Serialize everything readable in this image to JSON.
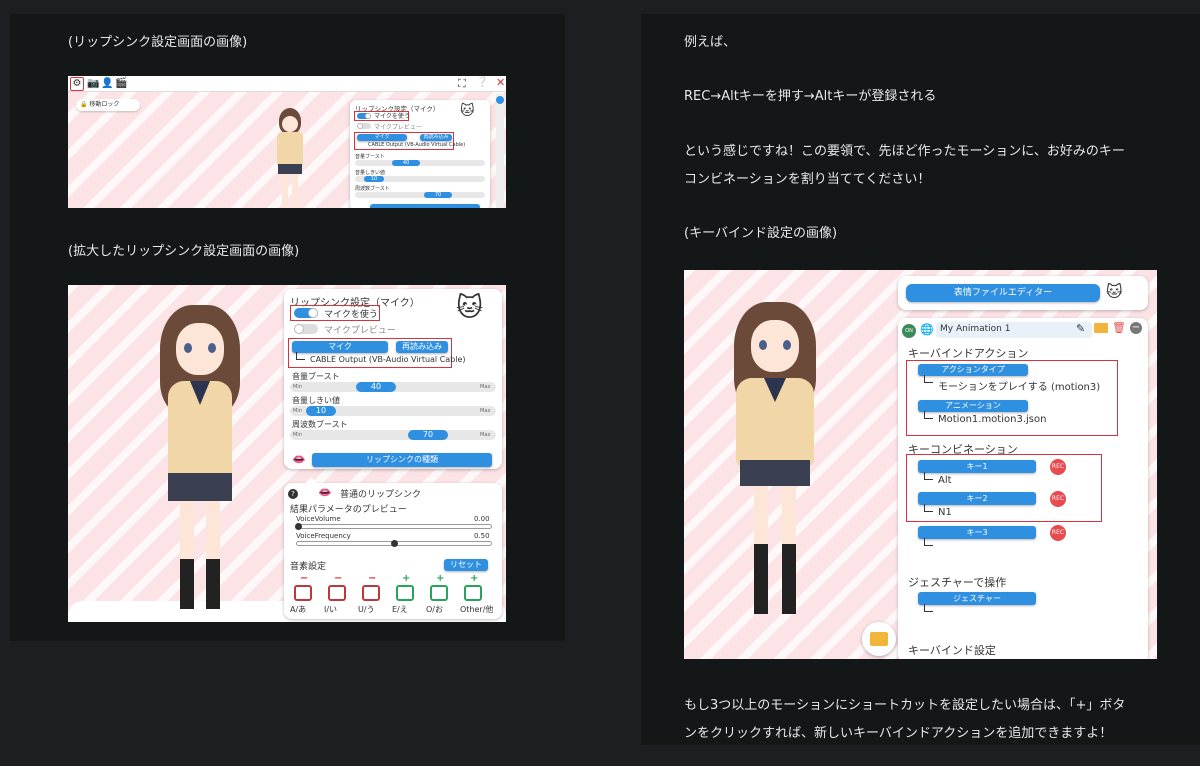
{
  "left": {
    "caption_1": "(リップシンク設定画面の画像)",
    "caption_2": "(拡大したリップシンク設定画面の画像)",
    "small_shot": {
      "lock_label": "移動ロック",
      "panel_title": "リップシンク設定（マイク）",
      "use_mic": "マイクを使う",
      "mic_preview": "マイクプレビュー",
      "mic_btn": "マイク",
      "reload_btn": "再読み込み",
      "device": "CABLE Output (VB-Audio Virtual Cable)",
      "volume_boost": "音量ブースト",
      "volume_threshold": "音量しきい値",
      "freq_boost": "周波数ブースト",
      "min": "Min",
      "max": "Max",
      "v1": "40",
      "v2": "10",
      "v3": "70"
    },
    "big_shot": {
      "panel_title": "リップシンク設定（マイク）",
      "use_mic": "マイクを使う",
      "mic_preview": "マイクプレビュー",
      "mic_btn": "マイク",
      "reload_btn": "再読み込み",
      "device": "CABLE Output (VB-Audio Virtual Cable)",
      "volume_boost": "音量ブースト",
      "volume_threshold": "音量しきい値",
      "freq_boost": "周波数ブースト",
      "min": "Min",
      "max": "Max",
      "v1": "40",
      "v2": "10",
      "v3": "70",
      "lipsync_type_btn": "リップシンクの種類",
      "normal_lipsync": "普通のリップシンク",
      "result_preview": "結果パラメータのプレビュー",
      "voice_volume": "VoiceVolume",
      "voice_volume_val": "0.00",
      "voice_freq": "VoiceFrequency",
      "voice_freq_val": "0.50",
      "phoneme_settings": "音素設定",
      "reset_btn": "リセット",
      "phonemes": [
        "A/あ",
        "I/い",
        "U/う",
        "E/え",
        "O/お",
        "Other/他"
      ]
    }
  },
  "right": {
    "para_1": "例えば、",
    "para_2": "REC→Altキーを押す→Altキーが登録される",
    "para_3a": "という感じですね！この要領で、先ほど作ったモーションに、お好みのキー",
    "para_3b": "コンビネーションを割り当ててください！",
    "caption": "(キーバインド設定の画像)",
    "para_4a": "もし3つ以上のモーションにショートカットを設定したい場合は、「+」ボタ",
    "para_4b": "ンをクリックすれば、新しいキーバインドアクションを追加できますよ！",
    "shot": {
      "editor_btn": "表情ファイルエディター",
      "toggle_on": "ON",
      "anim_name": "My Animation 1",
      "keybind_action": "キーバインドアクション",
      "action_type_btn": "アクションタイプ",
      "action_type_val": "モーションをプレイする (motion3)",
      "animation_btn": "アニメーション",
      "animation_val": "Motion1.motion3.json",
      "key_combo": "キーコンビネーション",
      "key1_btn": "キー1",
      "key1_val": "Alt",
      "key2_btn": "キー2",
      "key2_val": "N1",
      "key3_btn": "キー3",
      "rec": "REC",
      "gesture": "ジェスチャーで操作",
      "gesture_btn": "ジェスチャー",
      "keybind_settings": "キーバインド設定"
    }
  },
  "colors": {
    "accent": "#2f8fe0",
    "highlight": "#d8323a",
    "bg": "#1b1f21",
    "panel": "#131718"
  }
}
